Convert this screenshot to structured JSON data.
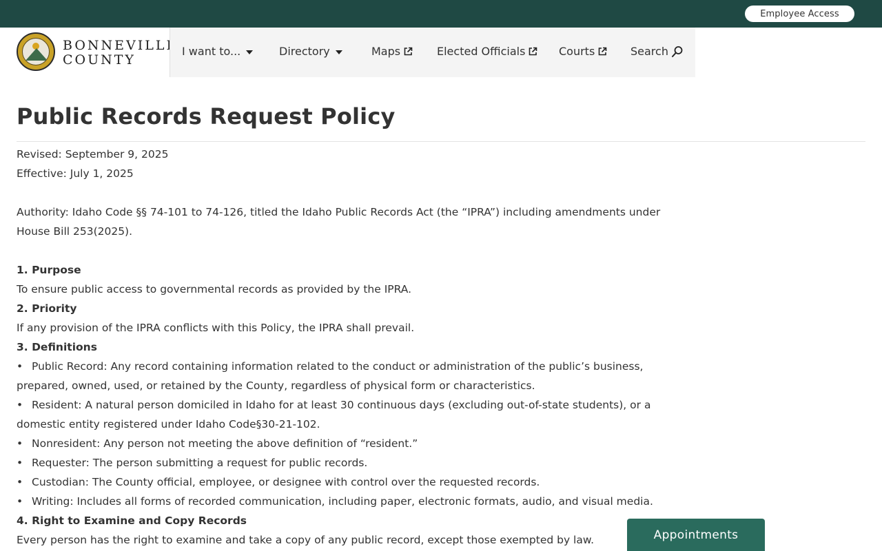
{
  "header": {
    "employee_access": "Employee Access",
    "brand_line1": "BONNEVILLE",
    "brand_line2": "COUNTY"
  },
  "nav": {
    "items": [
      {
        "label": "I want to...",
        "icon": "caret-down-icon"
      },
      {
        "label": "Directory",
        "icon": "caret-down-icon"
      },
      {
        "label": "Maps",
        "icon": "external-link-icon"
      },
      {
        "label": "Elected Officials",
        "icon": "external-link-icon"
      },
      {
        "label": "Courts",
        "icon": "external-link-icon"
      },
      {
        "label": "Search",
        "icon": "search-icon"
      }
    ]
  },
  "page": {
    "title": "Public Records Request Policy",
    "revised": "Revised: September 9, 2025",
    "effective": "Effective: July 1, 2025",
    "authority_1": "Authority: Idaho Code §§ 74-101 to 74-126, titled the Idaho Public Records Act (the “IPRA”) including amendments under",
    "authority_2": "House Bill 253(2025).",
    "s1_heading": "1. Purpose",
    "s1_text": "To ensure public access to governmental records as provided by the IPRA.",
    "s2_heading": "2. Priority",
    "s2_text": "If any provision of the IPRA conflicts with this Policy, the IPRA shall prevail.",
    "s3_heading": "3. Definitions",
    "def1_a": "Public Record: Any record containing information related to the conduct or administration of the public’s business,",
    "def1_b": "prepared, owned, used, or retained by the County, regardless of physical form or characteristics.",
    "def2_a": "Resident: A natural person domiciled in Idaho for at least 30 continuous days (excluding out-of-state students), or a",
    "def2_b": "domestic entity registered under Idaho Code§30-21-102.",
    "def3": "Nonresident: Any person not meeting the above definition of “resident.”",
    "def4": "Requester: The person submitting a request for public records.",
    "def5": "Custodian: The County official, employee, or designee with control over the requested records.",
    "def6": "Writing: Includes all forms of recorded communication, including paper, electronic formats, audio, and visual media.",
    "s4_heading": "4. Right to Examine and Copy Records",
    "s4_text": "Every person has the right to examine and take a copy of any public record, except those exempted by law.",
    "bullet": "•"
  },
  "appointments": "Appointments",
  "colors": {
    "topbar": "#1f4944",
    "nav_bg": "#f4f4f4",
    "appointments_bg": "#2a6b5d",
    "logo_gold": "#c9a227"
  }
}
